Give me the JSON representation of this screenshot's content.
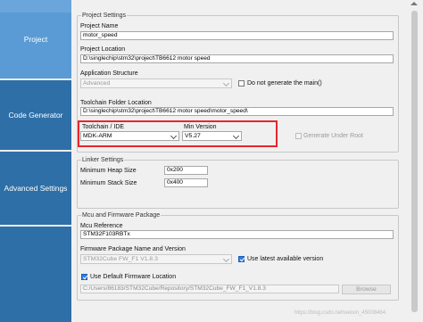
{
  "sidebar": {
    "project": "Project",
    "code_generator": "Code Generator",
    "advanced_settings": "Advanced Settings"
  },
  "project_settings": {
    "title": "Project Settings",
    "project_name_label": "Project Name",
    "project_name": "motor_speed",
    "project_location_label": "Project Location",
    "project_location": "D:\\singlechip\\stm32\\project\\TB6612 motor speed",
    "app_structure_label": "Application Structure",
    "app_structure": "Advanced",
    "no_main_label": "Do not generate the main()",
    "toolchain_folder_label": "Toolchain Folder Location",
    "toolchain_folder": "D:\\singlechip\\stm32\\project\\TB6612 motor speed\\motor_speed\\",
    "toolchain_ide_label": "Toolchain / IDE",
    "toolchain_ide": "MDK-ARM",
    "min_version_label": "Min Version",
    "min_version": "V5.27",
    "generate_under_root_label": "Generate Under Root"
  },
  "linker_settings": {
    "title": "Linker Settings",
    "min_heap_label": "Minimum Heap Size",
    "min_heap": "0x200",
    "min_stack_label": "Minimum Stack Size",
    "min_stack": "0x400"
  },
  "mcu_firmware": {
    "title": "Mcu and Firmware Package",
    "mcu_ref_label": "Mcu Reference",
    "mcu_ref": "STM32F103RBTx",
    "firmware_label": "Firmware Package Name and Version",
    "firmware": "STM32Cube FW_F1 V1.8.3",
    "use_latest_label": "Use latest available version",
    "use_default_label": "Use Default Firmware Location",
    "firmware_location": "C:/Users/86183/STM32Cube/Repository/STM32Cube_FW_F1_V1.8.3",
    "browse_label": "Browse"
  },
  "watermark": "https://blog.csdn.net/weixin_45008464"
}
